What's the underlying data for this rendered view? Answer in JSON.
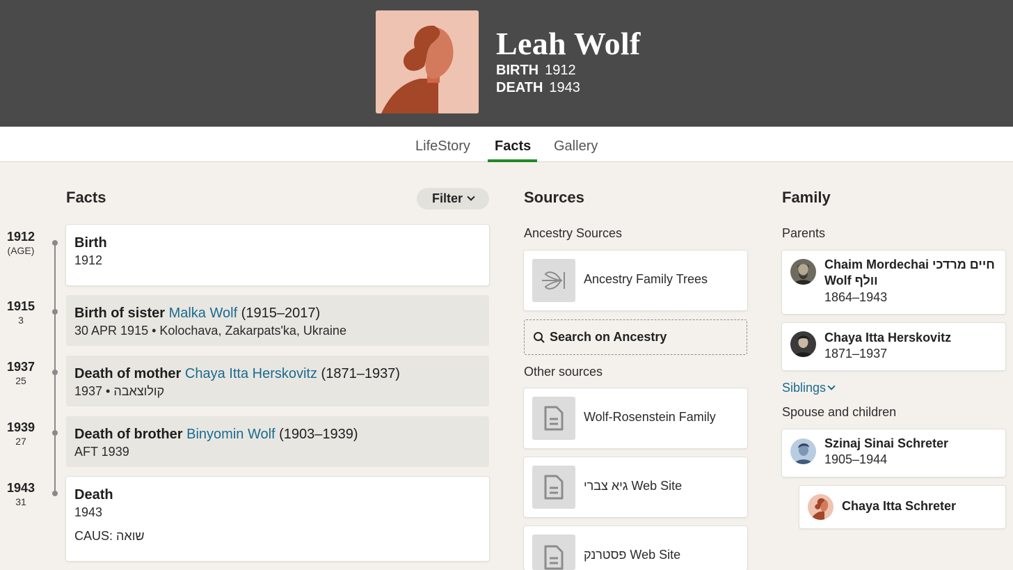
{
  "person": {
    "name": "Leah Wolf",
    "birth_label": "BIRTH",
    "birth_year": "1912",
    "death_label": "DEATH",
    "death_year": "1943"
  },
  "tabs": [
    {
      "label": "LifeStory"
    },
    {
      "label": "Facts",
      "active": true
    },
    {
      "label": "Gallery"
    }
  ],
  "facts": {
    "heading": "Facts",
    "filter_label": "Filter",
    "timeline": [
      {
        "year": "1912",
        "age": "(AGE)"
      },
      {
        "year": "1915",
        "age": "3"
      },
      {
        "year": "1937",
        "age": "25"
      },
      {
        "year": "1939",
        "age": "27"
      },
      {
        "year": "1943",
        "age": "31"
      }
    ],
    "items": [
      {
        "title": "Birth",
        "detail": "1912"
      },
      {
        "title_prefix": "Birth of sister ",
        "link": "Malka Wolf",
        "title_suffix": " (1915–2017)",
        "detail": "30 APR 1915 • Kolochava, Zakarpats'ka, Ukraine"
      },
      {
        "title_prefix": "Death of mother ",
        "link": "Chaya Itta Herskovitz",
        "title_suffix": " (1871–1937)",
        "detail": "1937 • קולוצאבה"
      },
      {
        "title_prefix": "Death of brother ",
        "link": "Binyomin Wolf",
        "title_suffix": " (1903–1939)",
        "detail": "AFT 1939"
      },
      {
        "title": "Death",
        "detail": "1943",
        "extra": "CAUS: שואה"
      }
    ]
  },
  "sources": {
    "heading": "Sources",
    "ancestry_heading": "Ancestry Sources",
    "ancestry_items": [
      {
        "label": "Ancestry Family Trees",
        "icon": "leaf-icon"
      }
    ],
    "search_label": "Search on Ancestry",
    "other_heading": "Other sources",
    "other_items": [
      {
        "label": "Wolf-Rosenstein Family",
        "icon": "document-icon"
      },
      {
        "label": "גיא צברי Web Site",
        "icon": "document-icon"
      },
      {
        "label": "פסטרנק Web Site",
        "icon": "document-icon"
      }
    ]
  },
  "family": {
    "heading": "Family",
    "parents_heading": "Parents",
    "parents": [
      {
        "name_line1": "Chaim Mordechai חיים מרדכי",
        "name_line2": "Wolf וולף",
        "dates": "1864–1943"
      },
      {
        "name": "Chaya Itta Herskovitz",
        "dates": "1871–1937"
      }
    ],
    "siblings_label": "Siblings",
    "spouse_heading": "Spouse and children",
    "spouse": {
      "name": "Szinaj Sinai Schreter",
      "dates": "1905–1944"
    },
    "children": [
      {
        "name": "Chaya Itta Schreter"
      }
    ]
  },
  "colors": {
    "header_bg": "#4a4a4a",
    "accent_green": "#1f8a2b",
    "link_blue": "#1a6b8f",
    "portrait_bg": "#eec3b1",
    "portrait_figure": "#a44628"
  }
}
